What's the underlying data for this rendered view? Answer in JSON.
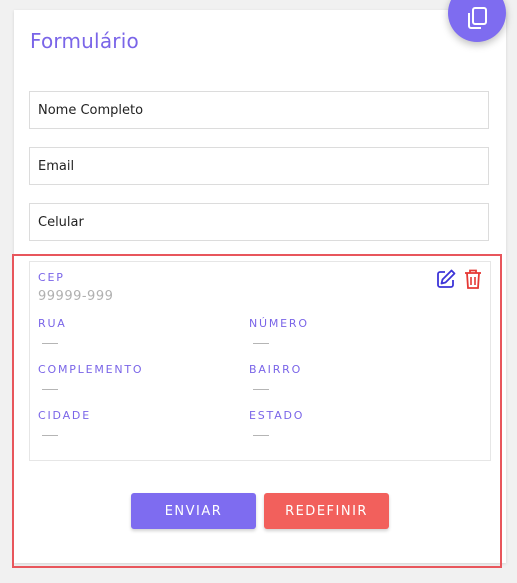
{
  "form": {
    "title": "Formulário",
    "fields": [
      {
        "name": "nome",
        "placeholder": "Nome Completo",
        "value": ""
      },
      {
        "name": "email",
        "placeholder": "Email",
        "value": ""
      },
      {
        "name": "celular",
        "placeholder": "Celular",
        "value": ""
      }
    ]
  },
  "address": {
    "cep_label": "CEP",
    "cep_value": "99999-999",
    "rua_label": "RUA",
    "numero_label": "NÚMERO",
    "complemento_label": "COMPLEMENTO",
    "bairro_label": "BAIRRO",
    "cidade_label": "CIDADE",
    "estado_label": "ESTADO",
    "icons": {
      "edit": "edit-icon",
      "delete": "trash-icon"
    }
  },
  "actions": {
    "send_label": "ENVIAR",
    "reset_label": "REDEFINIR"
  },
  "fab": {
    "icon": "copy-icon"
  },
  "colors": {
    "accent": "#7e6cf0",
    "danger": "#f2605c",
    "highlight": "#e8565c",
    "edit_icon": "#3d35d8",
    "delete_icon": "#e53935"
  }
}
